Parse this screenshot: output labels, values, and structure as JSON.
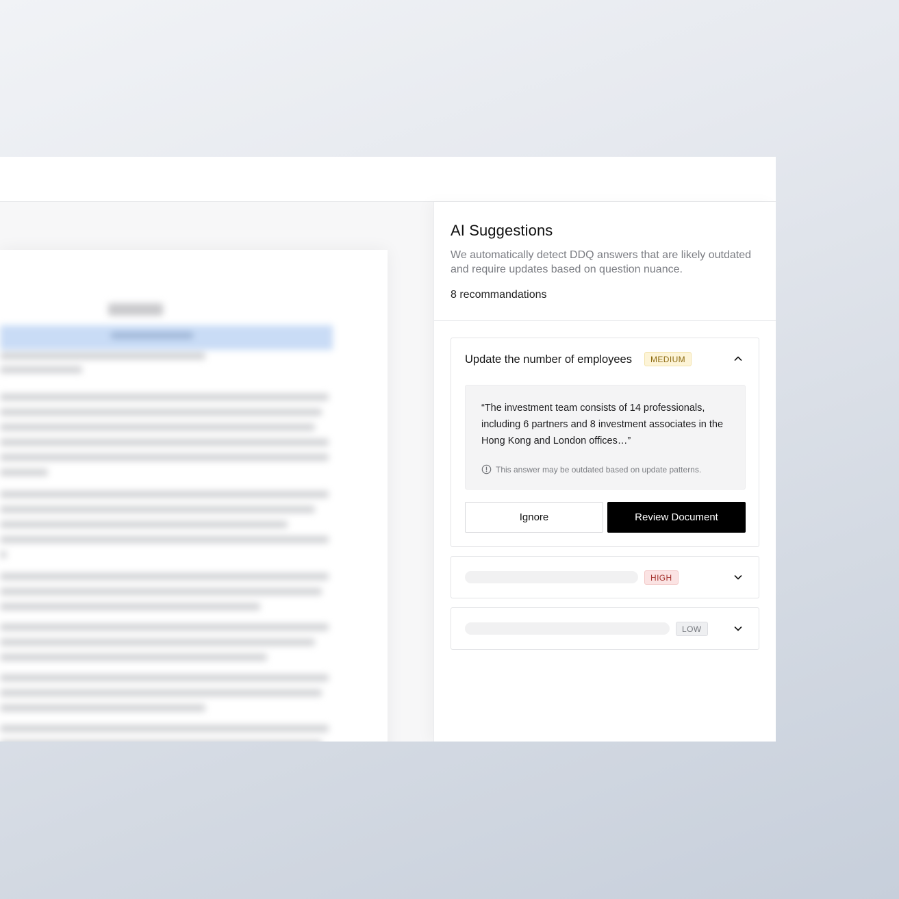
{
  "panel": {
    "title": "AI Suggestions",
    "description": "We automatically detect DDQ answers that are likely outdated and require updates based on question nuance.",
    "count_label": "8 recommandations"
  },
  "cards": [
    {
      "title": "Update the number of employees",
      "severity": "MEDIUM",
      "expanded": true,
      "quote": "“The investment team consists of 14 professionals, including 6 partners and 8 investment associates in the Hong Kong and London offices…”",
      "note": "This answer may be outdated based on update patterns.",
      "ignore_label": "Ignore",
      "review_label": "Review Document"
    },
    {
      "severity": "HIGH",
      "expanded": false
    },
    {
      "severity": "LOW",
      "expanded": false
    }
  ],
  "colors": {
    "medium_badge_bg": "#fdf4d7",
    "high_badge_bg": "#fbe3e3",
    "low_badge_bg": "#eeeff1",
    "primary_button": "#000000"
  },
  "icons": {
    "expanded": "chevron-up-icon",
    "collapsed": "chevron-down-icon",
    "note": "info-icon"
  }
}
